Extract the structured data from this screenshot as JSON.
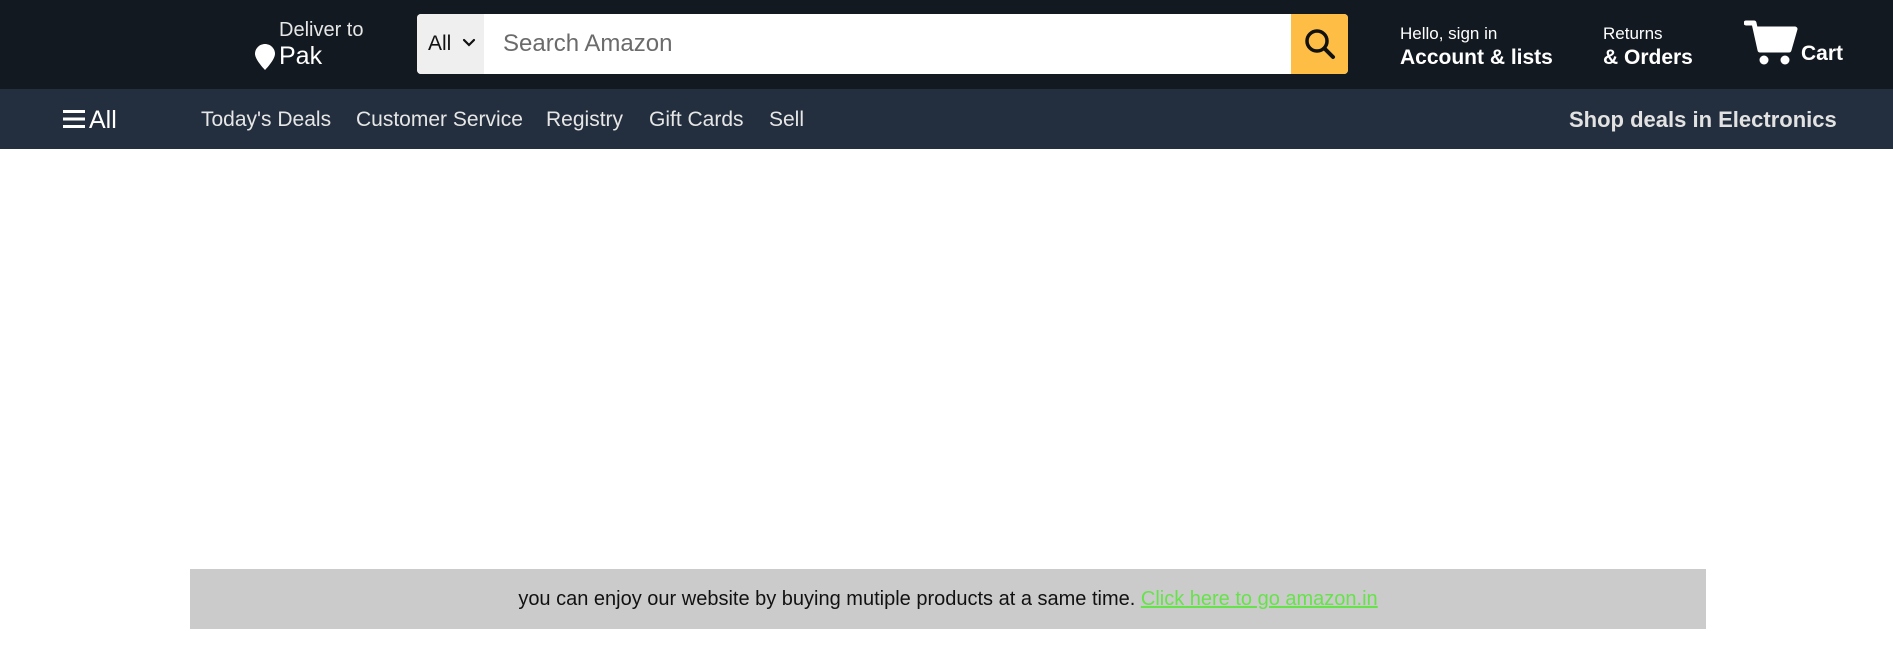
{
  "header": {
    "deliver": {
      "line1": "Deliver to",
      "location": "Pak"
    },
    "search": {
      "category": "All",
      "placeholder": "Search Amazon",
      "value": ""
    },
    "account": {
      "greeting": "Hello, sign in",
      "label": "Account & lists"
    },
    "returns": {
      "line1": "Returns",
      "line2": "& Orders"
    },
    "cart": {
      "label": "Cart"
    }
  },
  "nav": {
    "all_label": "All",
    "links": [
      "Today's Deals",
      "Customer Service",
      "Registry",
      "Gift Cards",
      "Sell"
    ],
    "promo": "Shop deals in Electronics"
  },
  "notice": {
    "text": "you can enjoy our website by buying mutiple products at a same time.",
    "link_text": "Click here to go amazon.in"
  },
  "colors": {
    "topbar": "#131921",
    "navbar": "#232f3e",
    "search_button": "#febd45",
    "notice_bg": "#cbcbcb",
    "notice_link": "#66e34a"
  },
  "icons": [
    "location-pin-icon",
    "chevron-down-icon",
    "search-icon",
    "cart-icon",
    "hamburger-icon"
  ]
}
